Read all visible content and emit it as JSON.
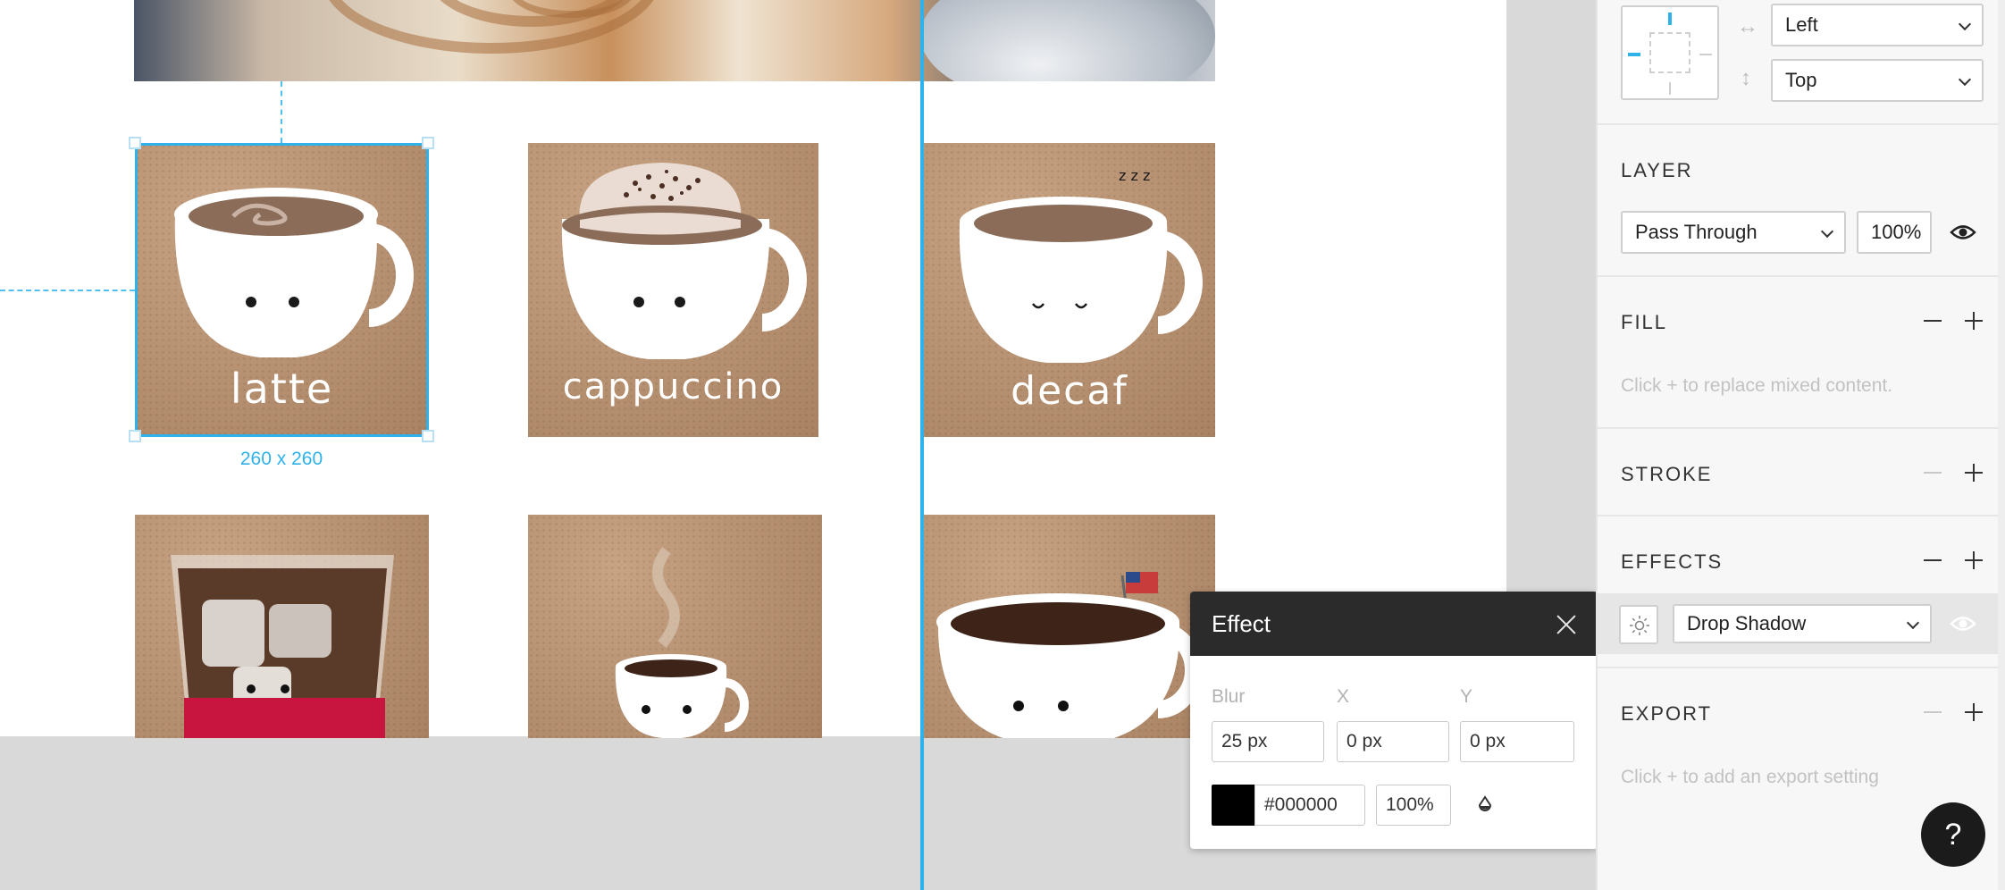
{
  "canvas": {
    "tiles": [
      {
        "label": "latte"
      },
      {
        "label": "cappuccino"
      },
      {
        "label": "decaf"
      }
    ],
    "selection_size_label": "260 x 260"
  },
  "effect_popup": {
    "title": "Effect",
    "labels": {
      "blur": "Blur",
      "x": "X",
      "y": "Y"
    },
    "blur_value": "25 px",
    "x_value": "0 px",
    "y_value": "0 px",
    "color_hex": "#000000",
    "opacity": "100%",
    "color": "#000000"
  },
  "panel": {
    "constraints": {
      "horizontal": "Left",
      "vertical": "Top"
    },
    "layer": {
      "title": "LAYER",
      "blend_mode": "Pass Through",
      "opacity": "100%"
    },
    "fill": {
      "title": "FILL",
      "hint": "Click + to replace mixed content."
    },
    "stroke": {
      "title": "STROKE"
    },
    "effects": {
      "title": "EFFECTS",
      "effect_type": "Drop Shadow"
    },
    "export": {
      "title": "EXPORT",
      "hint": "Click + to add an export setting"
    },
    "help_label": "?"
  },
  "colors": {
    "accent": "#2fb2ea",
    "popup_header": "#2b2b2b",
    "tile": "#b99474"
  }
}
